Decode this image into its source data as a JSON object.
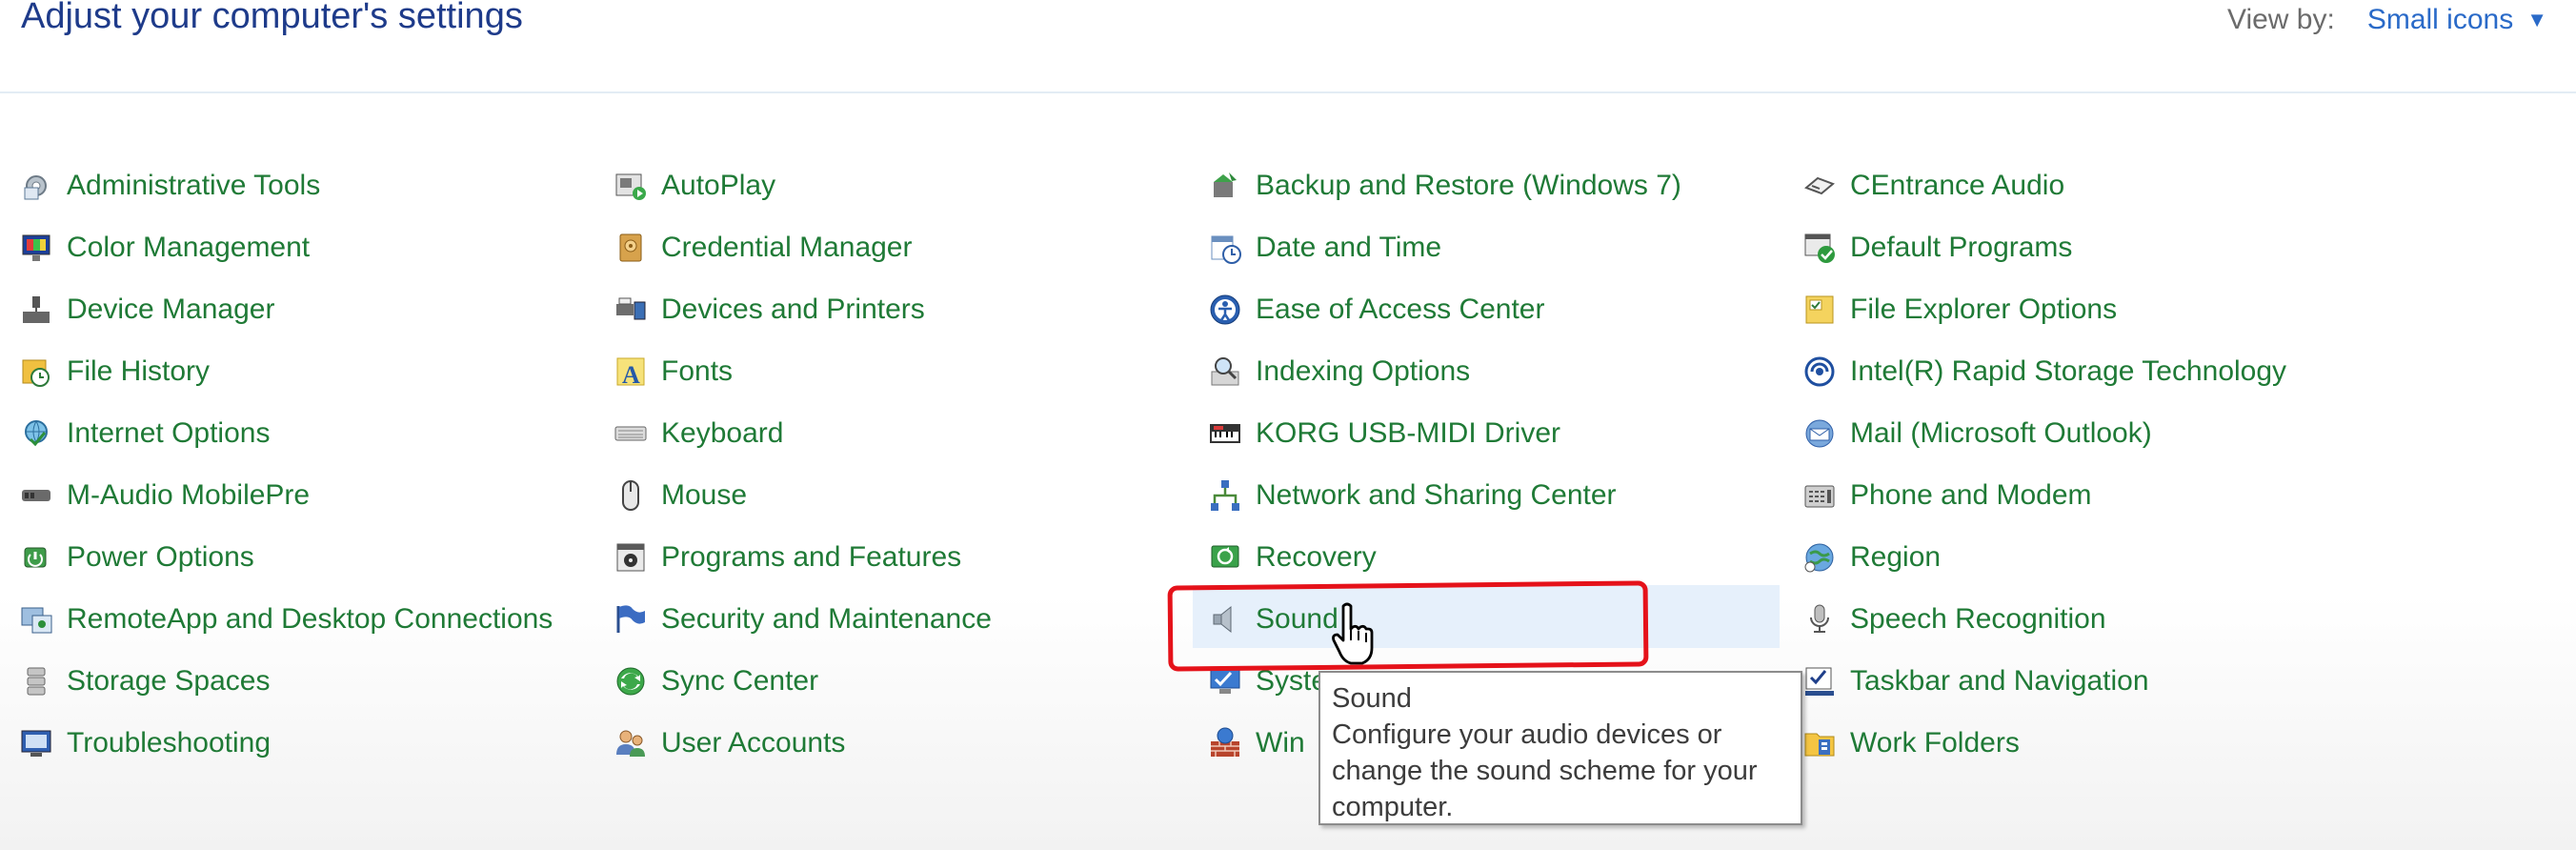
{
  "header": {
    "title": "Adjust your computer's settings",
    "view_by_label": "View by:",
    "view_by_value": "Small icons"
  },
  "columns": [
    [
      {
        "label": "Administrative Tools",
        "icon": "admin-tools-icon"
      },
      {
        "label": "Color Management",
        "icon": "color-management-icon"
      },
      {
        "label": "Device Manager",
        "icon": "device-manager-icon"
      },
      {
        "label": "File History",
        "icon": "file-history-icon"
      },
      {
        "label": "Internet Options",
        "icon": "internet-options-icon"
      },
      {
        "label": "M-Audio MobilePre",
        "icon": "m-audio-icon"
      },
      {
        "label": "Power Options",
        "icon": "power-options-icon"
      },
      {
        "label": "RemoteApp and Desktop Connections",
        "icon": "remoteapp-icon"
      },
      {
        "label": "Storage Spaces",
        "icon": "storage-spaces-icon"
      },
      {
        "label": "Troubleshooting",
        "icon": "troubleshooting-icon"
      }
    ],
    [
      {
        "label": "AutoPlay",
        "icon": "autoplay-icon"
      },
      {
        "label": "Credential Manager",
        "icon": "credential-manager-icon"
      },
      {
        "label": "Devices and Printers",
        "icon": "devices-printers-icon"
      },
      {
        "label": "Fonts",
        "icon": "fonts-icon"
      },
      {
        "label": "Keyboard",
        "icon": "keyboard-icon"
      },
      {
        "label": "Mouse",
        "icon": "mouse-icon"
      },
      {
        "label": "Programs and Features",
        "icon": "programs-features-icon"
      },
      {
        "label": "Security and Maintenance",
        "icon": "security-flag-icon"
      },
      {
        "label": "Sync Center",
        "icon": "sync-center-icon"
      },
      {
        "label": "User Accounts",
        "icon": "user-accounts-icon"
      }
    ],
    [
      {
        "label": "Backup and Restore (Windows 7)",
        "icon": "backup-restore-icon"
      },
      {
        "label": "Date and Time",
        "icon": "date-time-icon"
      },
      {
        "label": "Ease of Access Center",
        "icon": "ease-of-access-icon"
      },
      {
        "label": "Indexing Options",
        "icon": "indexing-options-icon"
      },
      {
        "label": "KORG USB-MIDI Driver",
        "icon": "korg-midi-icon"
      },
      {
        "label": "Network and Sharing Center",
        "icon": "network-sharing-icon"
      },
      {
        "label": "Recovery",
        "icon": "recovery-icon"
      },
      {
        "label": "Sound",
        "icon": "speaker-icon"
      },
      {
        "label": "Syste",
        "icon": "system-icon"
      },
      {
        "label": "Win",
        "icon": "firewall-icon"
      }
    ],
    [
      {
        "label": "CEntrance Audio",
        "icon": "centrance-audio-icon"
      },
      {
        "label": "Default Programs",
        "icon": "default-programs-icon"
      },
      {
        "label": "File Explorer Options",
        "icon": "file-explorer-options-icon"
      },
      {
        "label": "Intel(R) Rapid Storage Technology",
        "icon": "intel-rst-icon"
      },
      {
        "label": "Mail (Microsoft Outlook)",
        "icon": "mail-icon"
      },
      {
        "label": "Phone and Modem",
        "icon": "phone-modem-icon"
      },
      {
        "label": "Region",
        "icon": "region-icon"
      },
      {
        "label": "Speech Recognition",
        "icon": "microphone-icon"
      },
      {
        "label": "Taskbar and Navigation",
        "icon": "taskbar-navigation-icon"
      },
      {
        "label": "Work Folders",
        "icon": "work-folders-icon"
      }
    ]
  ],
  "tooltip": {
    "title": "Sound",
    "text": "Configure your audio devices or change the sound scheme for your computer."
  },
  "colors": {
    "title": "#1e3b8a",
    "link": "#1f7a36",
    "view_by_value": "#2a6ac8",
    "highlight": "#e5121a",
    "hover": "#e6f0fb"
  }
}
